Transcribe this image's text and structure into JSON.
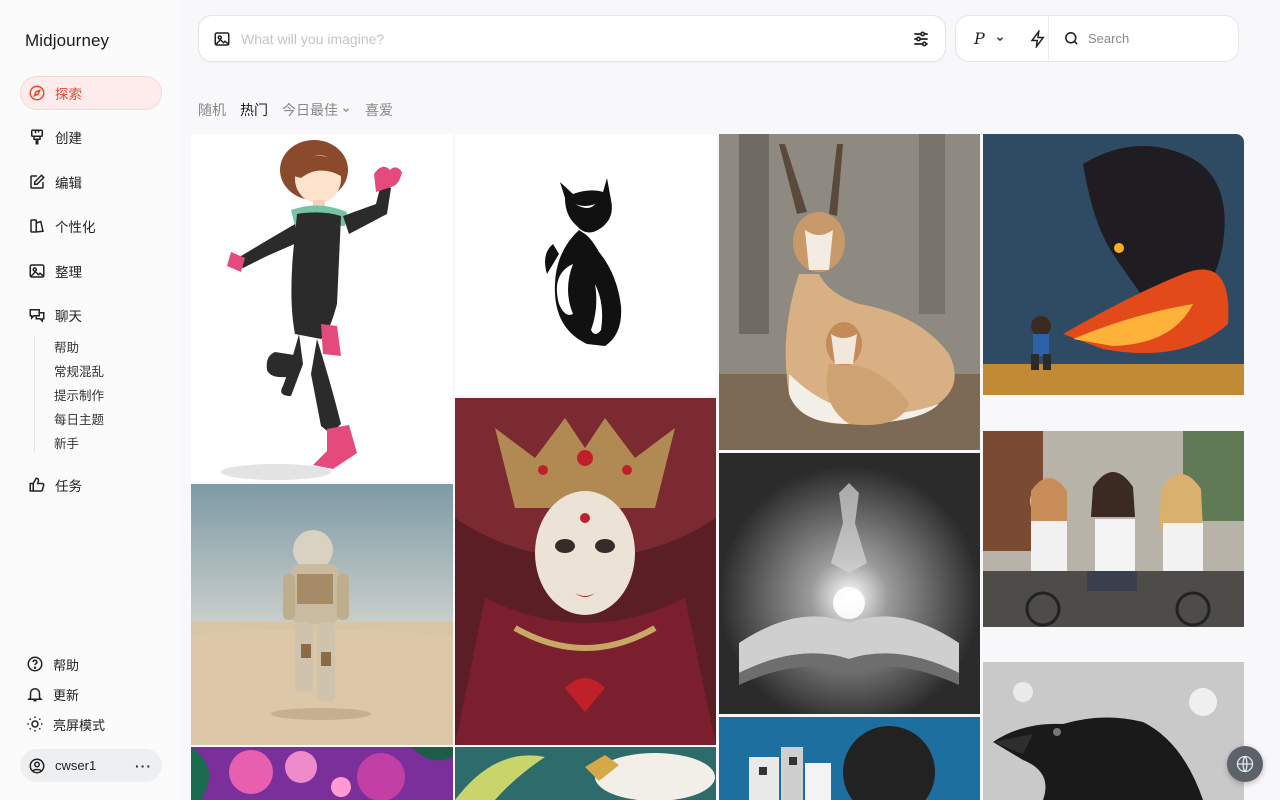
{
  "app": {
    "brand": "Midjourney"
  },
  "sidebar": {
    "nav": [
      {
        "label": "探索",
        "icon": "compass-icon",
        "active": true
      },
      {
        "label": "创建",
        "icon": "paintbrush-icon"
      },
      {
        "label": "编辑",
        "icon": "edit-icon"
      },
      {
        "label": "个性化",
        "icon": "personalize-icon"
      },
      {
        "label": "整理",
        "icon": "image-icon"
      },
      {
        "label": "聊天",
        "icon": "chat-icon"
      }
    ],
    "chat_rooms": [
      "帮助",
      "常规混乱",
      "提示制作",
      "每日主题",
      "新手"
    ],
    "tasks": {
      "label": "任务",
      "icon": "thumbs-up-icon"
    },
    "footer": [
      {
        "label": "帮助",
        "icon": "help-icon"
      },
      {
        "label": "更新",
        "icon": "bell-icon"
      },
      {
        "label": "亮屏模式",
        "icon": "sun-icon"
      }
    ],
    "user": {
      "name": "cwser1",
      "menu": "···"
    }
  },
  "topbar": {
    "prompt_placeholder": "What will you imagine?",
    "model_letter": "P",
    "search_placeholder": "Search"
  },
  "tabs": [
    {
      "label": "随机",
      "active": false
    },
    {
      "label": "热门",
      "active": true
    },
    {
      "label": "今日最佳",
      "active": false,
      "dropdown": true
    },
    {
      "label": "喜爱",
      "active": false
    }
  ],
  "gallery": [
    {
      "name": "anime-hero-girl",
      "col": 0
    },
    {
      "name": "astronaut-desert",
      "col": 0
    },
    {
      "name": "colorful-floral",
      "col": 0
    },
    {
      "name": "black-cat-logo",
      "col": 1
    },
    {
      "name": "queen-of-hearts-portrait",
      "col": 1
    },
    {
      "name": "banana-clouds",
      "col": 1
    },
    {
      "name": "gazelles",
      "col": 2
    },
    {
      "name": "magic-book",
      "col": 2
    },
    {
      "name": "curly-hair-collage",
      "col": 2
    },
    {
      "name": "fire-monster",
      "col": 3
    },
    {
      "name": "girls-on-bicycles",
      "col": 3
    },
    {
      "name": "black-crow",
      "col": 3
    }
  ],
  "colors": {
    "accent": "#e34a32",
    "active_bg": "#fdeceb"
  }
}
